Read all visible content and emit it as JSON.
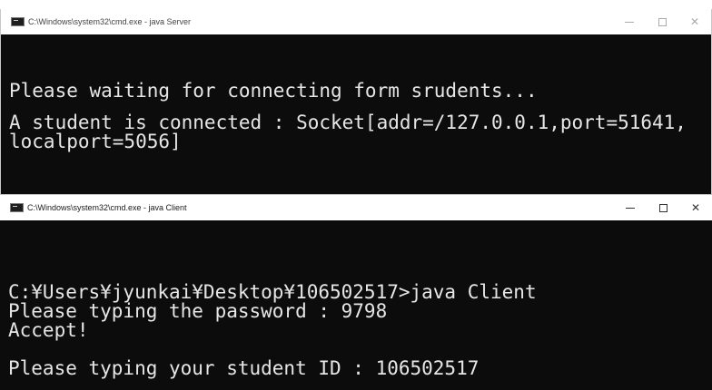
{
  "server_window": {
    "title": "C:\\Windows\\system32\\cmd.exe - java  Server",
    "controls": {
      "minimize": "–",
      "maximize": "□",
      "close": "✕"
    },
    "lines": [
      "Please waiting for connecting form srudents...",
      "",
      "A student is connected : Socket[addr=/127.0.0.1,port=51641,",
      "localport=5056]"
    ]
  },
  "client_window": {
    "title": "C:\\Windows\\system32\\cmd.exe - java  Client",
    "controls": {
      "minimize": "–",
      "maximize": "□",
      "close": "✕"
    },
    "lines": [
      "",
      "C:¥Users¥jyunkai¥Desktop¥106502517>java Client",
      "Please typing the password : 9798",
      "Accept!",
      "",
      "Please typing your student ID : 106502517"
    ]
  },
  "colors": {
    "console_bg": "#0c0c0c",
    "console_text": "#e6e6e6",
    "titlebar_bg": "#ffffff"
  },
  "icons": {
    "app": "cmd-console-icon",
    "minimize": "minimize-icon",
    "maximize": "maximize-icon",
    "close": "close-icon"
  }
}
